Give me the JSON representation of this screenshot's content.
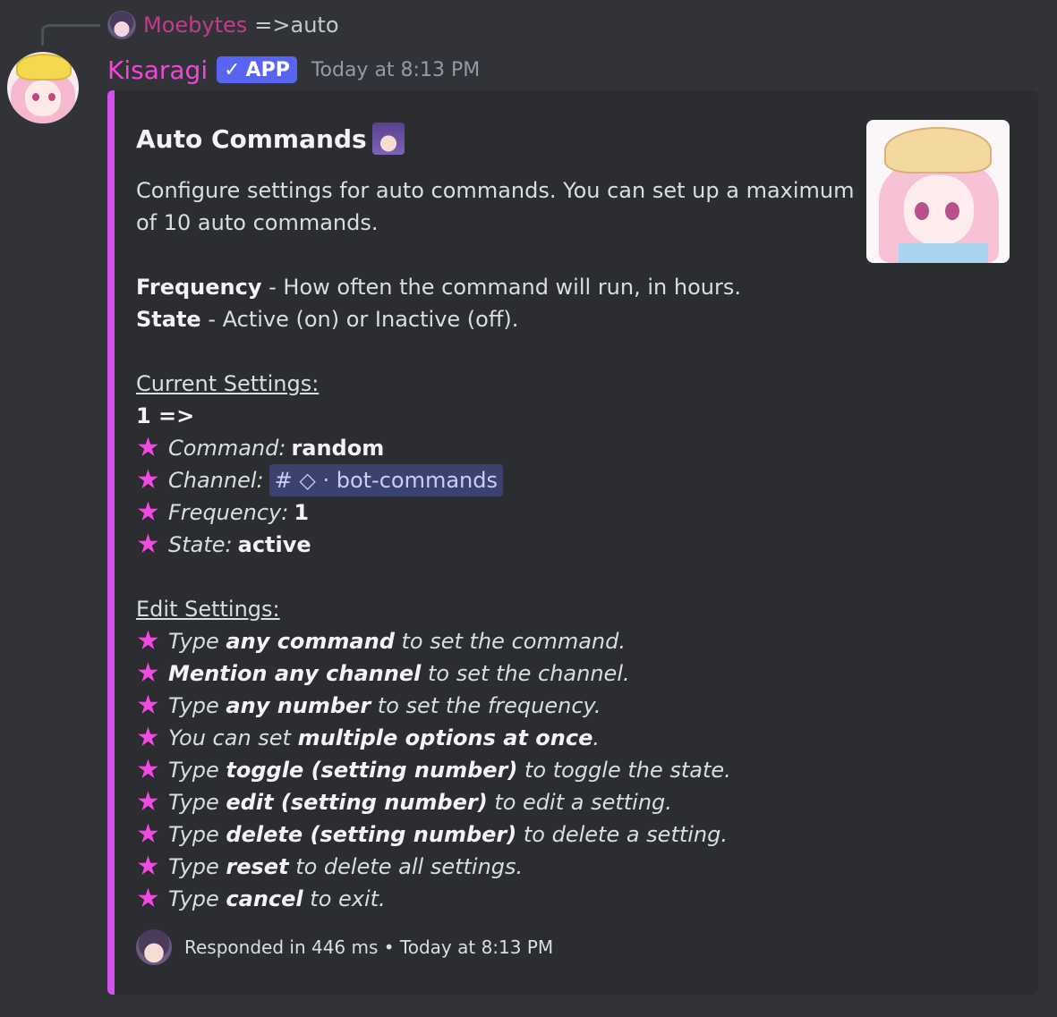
{
  "reply": {
    "author": "Moebytes",
    "text": "=>auto"
  },
  "message": {
    "author": "Kisaragi",
    "badge": "APP",
    "badge_check": "✓",
    "timestamp": "Today at 8:13 PM"
  },
  "colors": {
    "embed_accent": "#d64ff0",
    "author_color": "#f047d6",
    "reply_author_color": "#c23c8c",
    "badge": "#5865f2",
    "star": "#f24ae0"
  },
  "embed": {
    "title": "Auto Commands",
    "description_1": "Configure settings for auto commands. You can set up a maximum",
    "description_2": "of 10 auto commands.",
    "frequency_label": "Frequency",
    "frequency_desc": " - How often the command will run, in hours.",
    "state_label": "State",
    "state_desc": " - Active (on) or Inactive (off).",
    "current_heading": "Current Settings:",
    "entry_index": "1 =>",
    "current": {
      "command_label": "Command:",
      "command_value": "random",
      "channel_label": "Channel:",
      "channel_mention": "# ◇ · bot-commands",
      "frequency_label": "Frequency:",
      "frequency_value": "1",
      "state_label": "State:",
      "state_value": "active"
    },
    "edit_heading": "Edit Settings:",
    "edit": [
      {
        "pre": "Type ",
        "bold": "any command",
        "post": " to set the command."
      },
      {
        "pre": "",
        "bold": "Mention any channel",
        "post": " to set the channel."
      },
      {
        "pre": "Type ",
        "bold": "any number",
        "post": " to set the frequency."
      },
      {
        "pre": "You can set ",
        "bold": "multiple options at once",
        "post": "."
      },
      {
        "pre": "Type ",
        "bold": "toggle (setting number)",
        "post": " to toggle the state."
      },
      {
        "pre": "Type ",
        "bold": "edit (setting number)",
        "post": " to edit a setting."
      },
      {
        "pre": "Type ",
        "bold": "delete (setting number)",
        "post": " to delete a setting."
      },
      {
        "pre": "Type ",
        "bold": "reset",
        "post": " to delete all settings."
      },
      {
        "pre": "Type ",
        "bold": "cancel",
        "post": " to exit."
      }
    ],
    "star_icon": "★",
    "footer": "Responded in 446 ms • Today at 8:13 PM"
  }
}
